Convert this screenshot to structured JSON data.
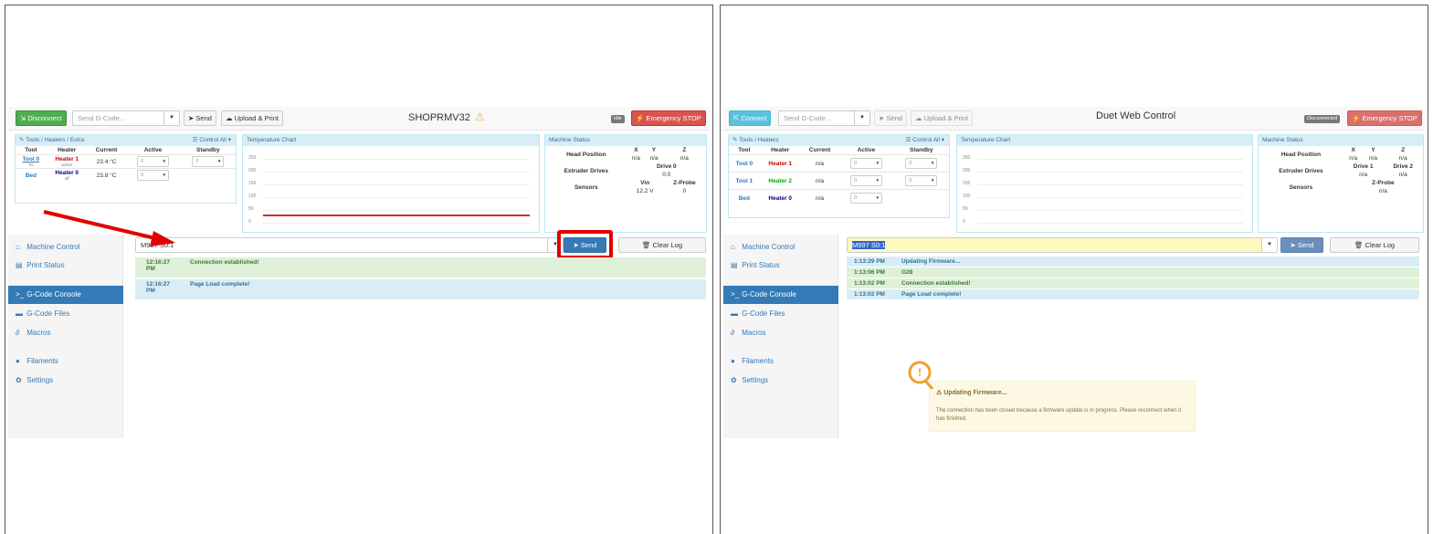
{
  "p1": {
    "disconnect_label": "Disconnect",
    "gcode_placeholder": "Send G-Code...",
    "send_label": "Send",
    "upload_label": "Upload & Print",
    "title": "SHOPRMV32",
    "status_badge": "Idle",
    "estop_label": "Emergency STOP",
    "tools_header": "Tools / Heaters / Extra",
    "control_all": "Control All",
    "cols": [
      "Tool",
      "Heater",
      "Current",
      "Active",
      "Standby"
    ],
    "rows": [
      {
        "tool": "Tool 0",
        "tool_sub": "T0",
        "heater": "Heater 1",
        "heater_sub": "active",
        "current": "23.4 °C",
        "active": "0",
        "standby": "0"
      },
      {
        "tool": "Bed",
        "heater": "Heater 0",
        "heater_sub": "off",
        "current": "23.8 °C",
        "active": "0"
      }
    ],
    "chart_title": "Temperature Chart",
    "chart_ticks": [
      "250",
      "200",
      "150",
      "100",
      "50",
      "0"
    ],
    "ms_title": "Machine Status",
    "head_position": "Head Position",
    "x": "X",
    "y": "Y",
    "z": "Z",
    "xv": "n/a",
    "yv": "n/a",
    "zv": "n/a",
    "extruder_drives": "Extruder Drives",
    "drive0": "Drive 0",
    "drive0v": "0.0",
    "sensors": "Sensors",
    "vin": "Vin",
    "zprobe": "Z-Probe",
    "vinv": "12.2 V",
    "zprobev": "0",
    "console_input": "M997 S0:1",
    "console_send": "Send",
    "clear_log": "Clear Log",
    "log": [
      {
        "time": "12:16:27 PM",
        "msg": "Connection established!"
      },
      {
        "time": "12:16:27 PM",
        "msg": "Page Load complete!"
      }
    ],
    "menu": [
      "Machine Control",
      "Print Status",
      "G-Code Console",
      "G-Code Files",
      "Macros",
      "Filaments",
      "Settings"
    ]
  },
  "p2": {
    "connect_label": "Connect",
    "gcode_placeholder": "Send G-Code...",
    "send_label": "Send",
    "upload_label": "Upload & Print",
    "title": "Duet Web Control",
    "status_badge": "Disconnected",
    "estop_label": "Emergency STOP",
    "tools_header": "Tools / Heaters",
    "control_all": "Control All",
    "cols": [
      "Tool",
      "Heater",
      "Current",
      "Active",
      "Standby"
    ],
    "rows": [
      {
        "tool": "Tool 0",
        "heater": "Heater 1",
        "current": "n/a",
        "active": "0",
        "standby": "0"
      },
      {
        "tool": "Tool 1",
        "heater": "Heater 2",
        "current": "n/a",
        "active": "0",
        "standby": "0"
      },
      {
        "tool": "Bed",
        "heater": "Heater 0",
        "current": "n/a",
        "active": "0"
      }
    ],
    "chart_title": "Temperature Chart",
    "chart_ticks": [
      "250",
      "200",
      "150",
      "100",
      "50",
      "0"
    ],
    "ms_title": "Machine Status",
    "head_position": "Head Position",
    "x": "X",
    "y": "Y",
    "z": "Z",
    "xv": "n/a",
    "yv": "n/a",
    "zv": "n/a",
    "extruder_drives": "Extruder Drives",
    "drive1": "Drive 1",
    "drive2": "Drive 2",
    "drive1v": "n/a",
    "drive2v": "n/a",
    "sensors": "Sensors",
    "zprobe": "Z-Probe",
    "zprobev": "n/a",
    "console_input": "M997 S0:1",
    "console_send": "Send",
    "clear_log": "Clear Log",
    "log": [
      {
        "time": "1:13:29 PM",
        "msg": "Updating Firmware..."
      },
      {
        "time": "1:13:06 PM",
        "msg": "G28"
      },
      {
        "time": "1:13:02 PM",
        "msg": "Connection established!"
      },
      {
        "time": "1:13:02 PM",
        "msg": "Page Load complete!"
      }
    ],
    "menu": [
      "Machine Control",
      "Print Status",
      "G-Code Console",
      "G-Code Files",
      "Macros",
      "Filaments",
      "Settings"
    ],
    "notif_title": "Updating Firmware...",
    "notif_body": "The connection has been closed because a firmware update is in progress. Please reconnect when it has finished."
  },
  "colors": {
    "primary": "#337ab7",
    "success": "#4cae4c",
    "danger": "#d9534f",
    "info": "#5bc0de",
    "warning": "#f0ad4e",
    "highlight": "#e00000"
  }
}
